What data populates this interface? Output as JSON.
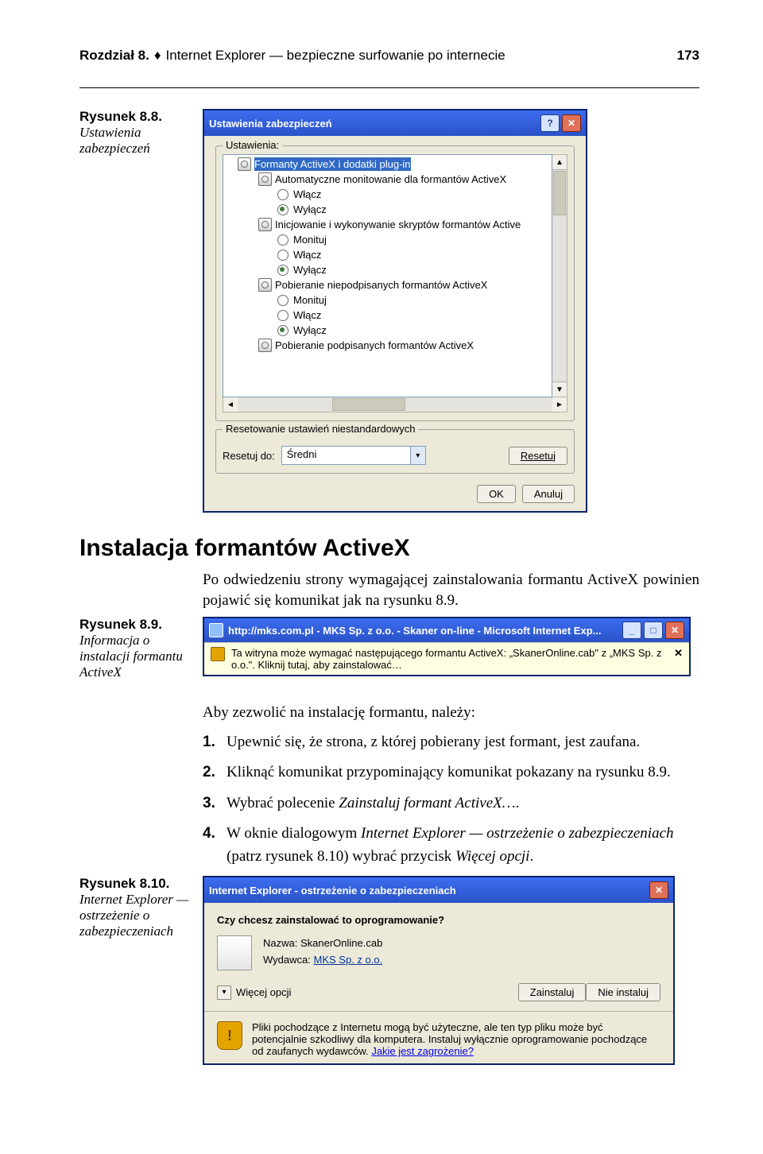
{
  "header": {
    "chapter": "Rozdział 8.",
    "title": "Internet Explorer — bezpieczne surfowanie po internecie",
    "page": "173"
  },
  "fig88": {
    "label": "Rysunek 8.8.",
    "caption": "Ustawienia zabezpieczeń",
    "dlg_title": "Ustawienia zabezpieczeń",
    "grp_settings": "Ustawienia:",
    "tree": {
      "n0": "Formanty ActiveX i dodatki plug-in",
      "n1": "Automatyczne monitowanie dla formantów ActiveX",
      "n1a": "Włącz",
      "n1b": "Wyłącz",
      "n2": "Inicjowanie i wykonywanie skryptów formantów Active",
      "n2a": "Monituj",
      "n2b": "Włącz",
      "n2c": "Wyłącz",
      "n3": "Pobieranie niepodpisanych formantów ActiveX",
      "n3a": "Monituj",
      "n3b": "Włącz",
      "n3c": "Wyłącz",
      "n4": "Pobieranie podpisanych formantów ActiveX"
    },
    "grp_reset": "Resetowanie ustawień niestandardowych",
    "reset_label": "Resetuj do:",
    "reset_value": "Średni",
    "reset_btn": "Resetuj",
    "ok": "OK",
    "cancel": "Anuluj"
  },
  "section": {
    "heading": "Instalacja formantów ActiveX",
    "p1": "Po odwiedzeniu strony wymagającej zainstalowania formantu ActiveX powinien pojawić się komunikat jak na rysunku 8.9."
  },
  "fig89": {
    "label": "Rysunek 8.9.",
    "caption": "Informacja o instalacji formantu ActiveX",
    "title": "http://mks.com.pl - MKS Sp. z o.o. - Skaner on-line - Microsoft Internet Exp...",
    "msg": "Ta witryna może wymagać następującego formantu ActiveX: „SkanerOnline.cab\" z „MKS Sp. z o.o.\". Kliknij tutaj, aby zainstalować…"
  },
  "para2": "Aby zezwolić na instalację formantu, należy:",
  "steps": {
    "s1": "Upewnić się, że strona, z której pobierany jest formant, jest zaufana.",
    "s2": "Kliknąć komunikat przypominający komunikat pokazany na rysunku 8.9.",
    "s3_a": "Wybrać polecenie ",
    "s3_b": "Zainstaluj formant ActiveX…",
    "s3_c": ".",
    "s4_a": "W oknie dialogowym ",
    "s4_b": "Internet Explorer — ostrzeżenie o zabezpieczeniach",
    "s4_c": " (patrz rysunek 8.10) wybrać przycisk ",
    "s4_d": "Więcej opcji",
    "s4_e": "."
  },
  "fig810": {
    "label": "Rysunek 8.10.",
    "caption": "Internet Explorer — ostrzeżenie o zabezpieczeniach",
    "title": "Internet Explorer - ostrzeżenie o zabezpieczeniach",
    "question": "Czy chcesz zainstalować to oprogramowanie?",
    "name_l": "Nazwa:",
    "name_v": "SkanerOnline.cab",
    "pub_l": "Wydawca:",
    "pub_v": "MKS Sp. z o.o.",
    "more": "Więcej opcji",
    "install": "Zainstaluj",
    "no": "Nie instaluj",
    "caution_a": "Pliki pochodzące z Internetu mogą być użyteczne, ale ten typ pliku może być potencjalnie szkodliwy dla komputera. Instaluj wyłącznie oprogramowanie pochodzące od zaufanych wydawców. ",
    "caution_b": "Jakie jest zagrożenie?"
  }
}
